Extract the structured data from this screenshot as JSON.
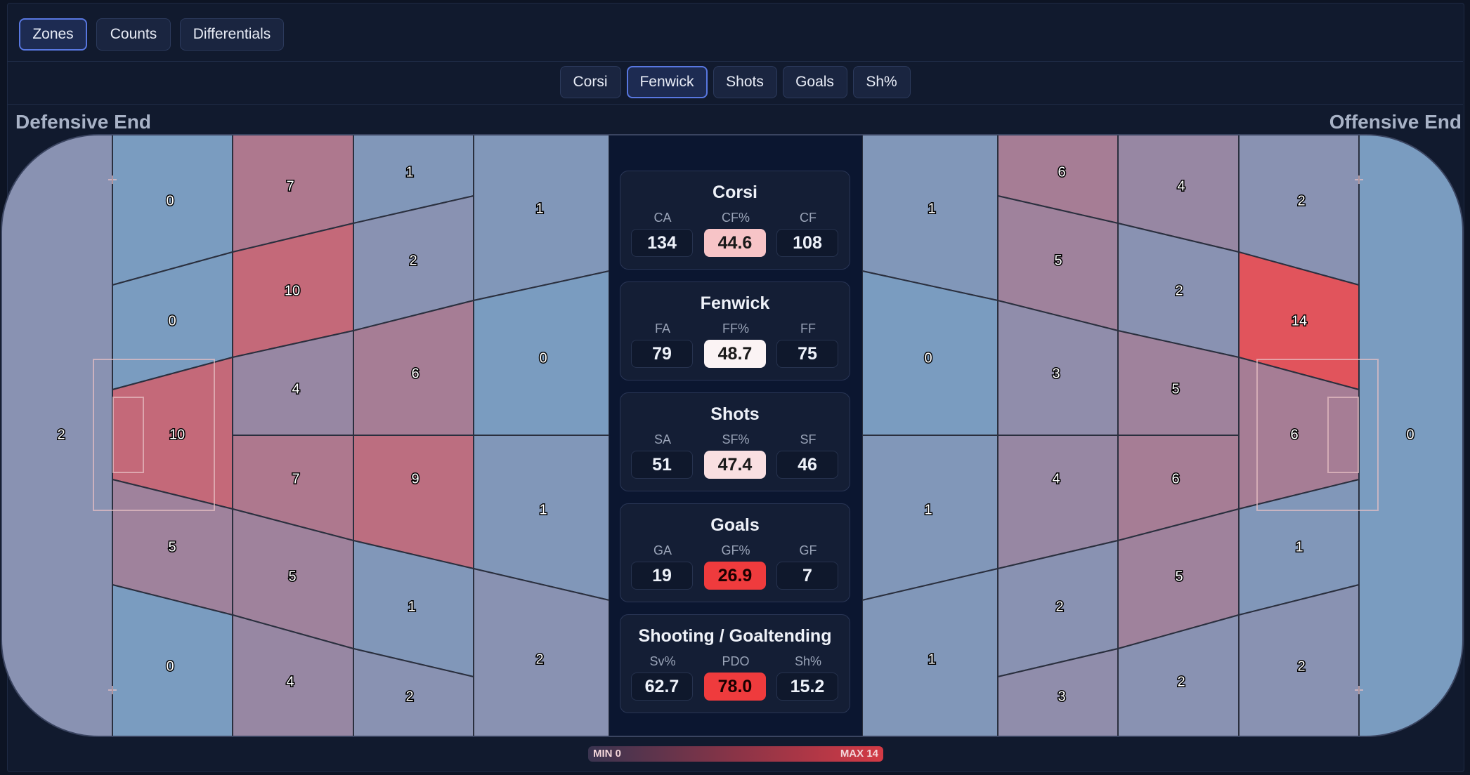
{
  "view_tabs": [
    {
      "label": "Zones",
      "active": true
    },
    {
      "label": "Counts",
      "active": false
    },
    {
      "label": "Differentials",
      "active": false
    }
  ],
  "metric_tabs": [
    {
      "label": "Corsi",
      "active": false
    },
    {
      "label": "Fenwick",
      "active": true
    },
    {
      "label": "Shots",
      "active": false
    },
    {
      "label": "Goals",
      "active": false
    },
    {
      "label": "Sh%",
      "active": false
    }
  ],
  "rink": {
    "left_label": "Defensive End",
    "right_label": "Offensive End",
    "defensive_zone_values": [
      2,
      0,
      0,
      10,
      5,
      0,
      7,
      10,
      4,
      7,
      5,
      4,
      1,
      2,
      6,
      9,
      1,
      2,
      1,
      0,
      1,
      2
    ],
    "offensive_zone_values": [
      1,
      0,
      1,
      1,
      3,
      6,
      5,
      3,
      4,
      2,
      2,
      4,
      2,
      5,
      6,
      5,
      2,
      2,
      14,
      6,
      1,
      0
    ]
  },
  "stats": [
    {
      "title": "Corsi",
      "labels": [
        "CA",
        "CF%",
        "CF"
      ],
      "values": [
        "134",
        "44.6",
        "108"
      ],
      "pct_color": "#f7c4c7"
    },
    {
      "title": "Fenwick",
      "labels": [
        "FA",
        "FF%",
        "FF"
      ],
      "values": [
        "79",
        "48.7",
        "75"
      ],
      "pct_color": "#fbf3f4"
    },
    {
      "title": "Shots",
      "labels": [
        "SA",
        "SF%",
        "SF"
      ],
      "values": [
        "51",
        "47.4",
        "46"
      ],
      "pct_color": "#f9dfe1"
    },
    {
      "title": "Goals",
      "labels": [
        "GA",
        "GF%",
        "GF"
      ],
      "values": [
        "19",
        "26.9",
        "7"
      ],
      "pct_color": "#ef3b3d"
    },
    {
      "title": "Shooting / Goaltending",
      "labels": [
        "Sv%",
        "PDO",
        "Sh%"
      ],
      "values": [
        "62.7",
        "78.0",
        "15.2"
      ],
      "pct_color": "#ef3b3d"
    }
  ],
  "legend": {
    "min_label": "MIN 0",
    "max_label": "MAX 14"
  },
  "colors": {
    "accent": "#5877e0",
    "cold": "#7a9cc0",
    "hot": "#e05660",
    "panel": "#111a2e"
  }
}
